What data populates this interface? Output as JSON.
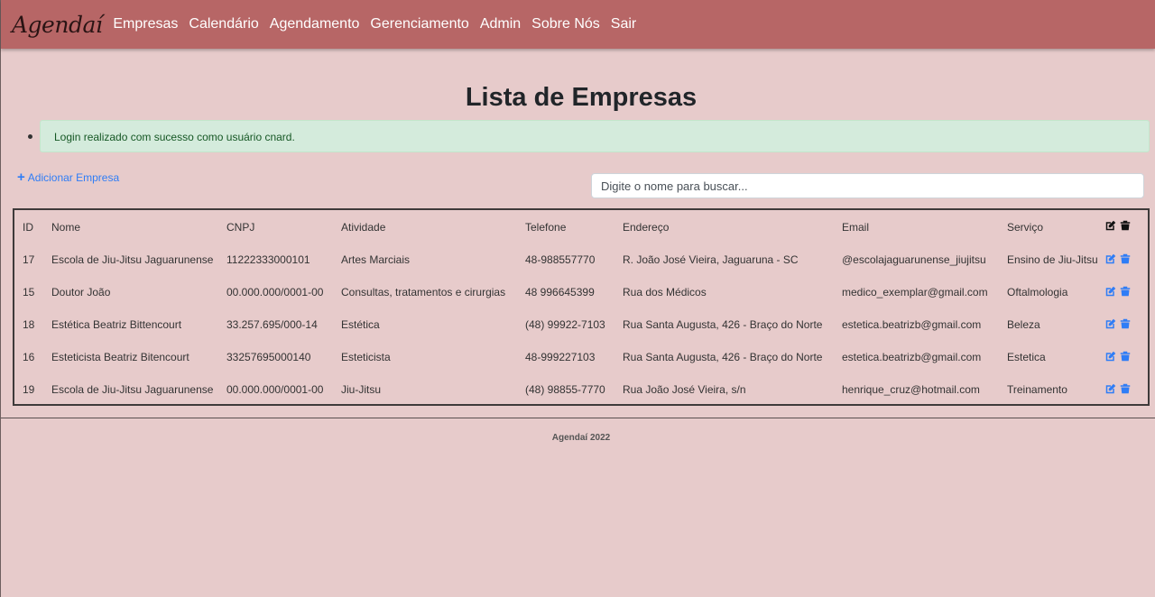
{
  "nav": {
    "brand": "Agendaí",
    "links": [
      "Empresas",
      "Calendário",
      "Agendamento",
      "Gerenciamento",
      "Admin",
      "Sobre Nós",
      "Sair"
    ]
  },
  "page": {
    "title": "Lista de Empresas",
    "flash": "Login realizado com sucesso como usuário cnard.",
    "add_label": "Adicionar Empresa",
    "search_placeholder": "Digite o nome para buscar..."
  },
  "table": {
    "headers": [
      "ID",
      "Nome",
      "CNPJ",
      "Atividade",
      "Telefone",
      "Endereço",
      "Email",
      "Serviço"
    ],
    "rows": [
      [
        "17",
        "Escola de Jiu-Jitsu Jaguarunense",
        "11222333000101",
        "Artes Marciais",
        "48-988557770",
        "R. João José Vieira, Jaguaruna - SC",
        "@escolajaguarunense_jiujitsu",
        "Ensino de Jiu-Jitsu"
      ],
      [
        "15",
        "Doutor João",
        "00.000.000/0001-00",
        "Consultas, tratamentos e cirurgias",
        "48 996645399",
        "Rua dos Médicos",
        "medico_exemplar@gmail.com",
        "Oftalmologia"
      ],
      [
        "18",
        "Estética Beatriz Bittencourt",
        "33.257.695/000-14",
        "Estética",
        "(48) 99922-7103",
        "Rua Santa Augusta, 426 - Braço do Norte",
        "estetica.beatrizb@gmail.com",
        "Beleza"
      ],
      [
        "16",
        "Esteticista Beatriz Bitencourt",
        "33257695000140",
        "Esteticista",
        "48-999227103",
        "Rua Santa Augusta, 426 - Braço do Norte",
        "estetica.beatrizb@gmail.com",
        "Estetica"
      ],
      [
        "19",
        "Escola de Jiu-Jitsu Jaguarunense",
        "00.000.000/0001-00",
        "Jiu-Jitsu",
        "(48) 98855-7770",
        "Rua João José Vieira, s/n",
        "henrique_cruz@hotmail.com",
        "Treinamento"
      ]
    ]
  },
  "footer": "Agendaí 2022",
  "colors": {
    "navbar": "#b76666",
    "background": "#e7cbcb",
    "action_blue": "#2f7df6",
    "flash_bg": "#d4ebdc"
  }
}
